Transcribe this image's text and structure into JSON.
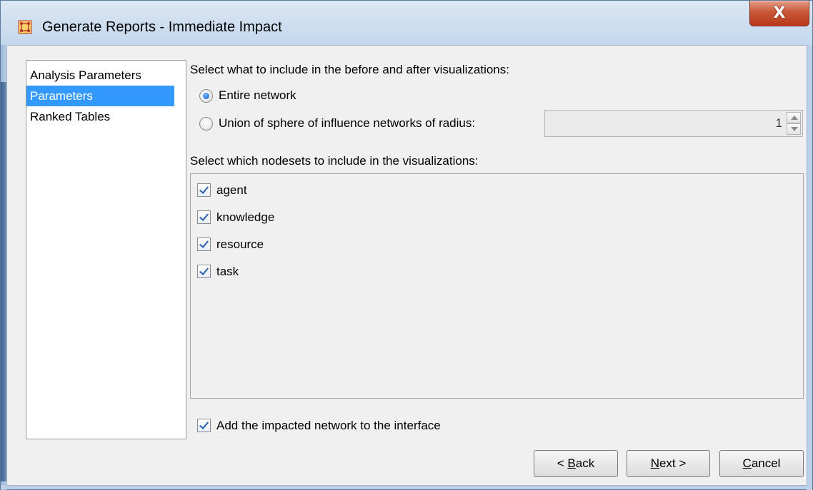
{
  "window": {
    "title": "Generate Reports - Immediate Impact",
    "close_glyph": "X",
    "app_icon": "network-grid-icon",
    "accent_color": "#3399ff"
  },
  "nav": {
    "items": [
      {
        "label": "Analysis Parameters",
        "selected": false
      },
      {
        "label": "Parameters",
        "selected": true
      },
      {
        "label": "Ranked Tables",
        "selected": false
      }
    ]
  },
  "visualization": {
    "prompt": "Select what to include in the before and after visualizations:",
    "option_entire": {
      "label": "Entire network",
      "checked": true
    },
    "option_union": {
      "label": "Union of sphere of influence networks of radius:",
      "checked": false
    },
    "radius_value": "1"
  },
  "nodesets": {
    "prompt": "Select which nodesets to include in the visualizations:",
    "items": [
      {
        "label": "agent",
        "checked": true
      },
      {
        "label": "knowledge",
        "checked": true
      },
      {
        "label": "resource",
        "checked": true
      },
      {
        "label": "task",
        "checked": true
      }
    ]
  },
  "add_network": {
    "label": "Add the impacted network to the interface",
    "checked": true
  },
  "buttons": {
    "back": {
      "prefix": "< ",
      "mnemonic": "B",
      "rest": "ack"
    },
    "next": {
      "prefix": "",
      "mnemonic": "N",
      "rest": "ext >"
    },
    "cancel": {
      "prefix": "",
      "mnemonic": "C",
      "rest": "ancel"
    }
  }
}
